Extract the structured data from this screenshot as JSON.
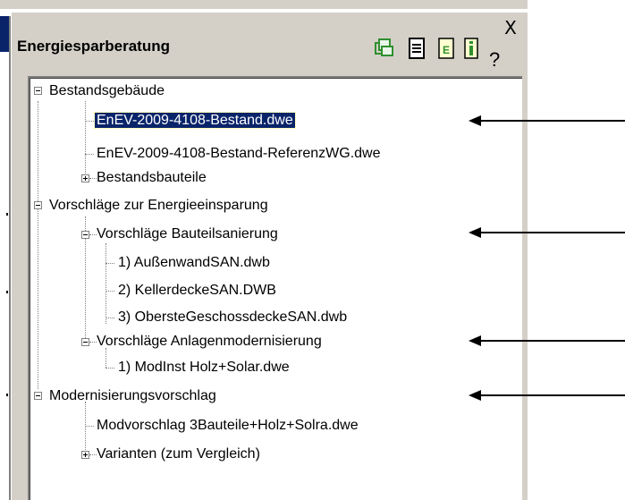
{
  "panel": {
    "title": "Energiesparberatung",
    "close_symbol": "X",
    "toolbar": [
      {
        "icon": "copy-files-icon",
        "color": "#2f8f2f"
      },
      {
        "icon": "document-list-icon",
        "color": "#000000"
      },
      {
        "icon": "energy-document-icon",
        "color": "#2f8f2f"
      },
      {
        "icon": "info-icon",
        "color": "#2f8f2f"
      },
      {
        "icon": "help-icon",
        "symbol": "?"
      }
    ]
  },
  "tree": {
    "nodes": [
      {
        "label": "Bestandsgebäude",
        "level": 0,
        "toggle": "minus"
      },
      {
        "label": "EnEV-2009-4108-Bestand.dwe",
        "level": 1,
        "selected": true
      },
      {
        "label": "EnEV-2009-4108-Bestand-ReferenzWG.dwe",
        "level": 1
      },
      {
        "label": "Bestandsbauteile",
        "level": 1,
        "toggle": "plus"
      },
      {
        "label": "Vorschläge zur Energieeinsparung",
        "level": 0,
        "toggle": "minus"
      },
      {
        "label": "Vorschläge Bauteilsanierung",
        "level": 1,
        "toggle": "minus"
      },
      {
        "label": "1) AußenwandSAN.dwb",
        "level": 2
      },
      {
        "label": "2) KellerdeckeSAN.DWB",
        "level": 2
      },
      {
        "label": "3) ObersteGeschossdeckeSAN.dwb",
        "level": 2
      },
      {
        "label": "Vorschläge Anlagenmodernisierung",
        "level": 1,
        "toggle": "minus"
      },
      {
        "label": "1) ModInst Holz+Solar.dwe",
        "level": 2
      },
      {
        "label": "Modernisierungsvorschlag",
        "level": 0,
        "toggle": "minus"
      },
      {
        "label": "Modvorschlag 3Bauteile+Holz+Solra.dwe",
        "level": 1
      },
      {
        "label": "Varianten (zum Vergleich)",
        "level": 1,
        "toggle": "plus"
      }
    ]
  },
  "colors": {
    "panel_bg": "#d4d0c8",
    "selection_bg": "#0a246a",
    "selection_fg": "#ffffff",
    "arrow": "#000000"
  }
}
